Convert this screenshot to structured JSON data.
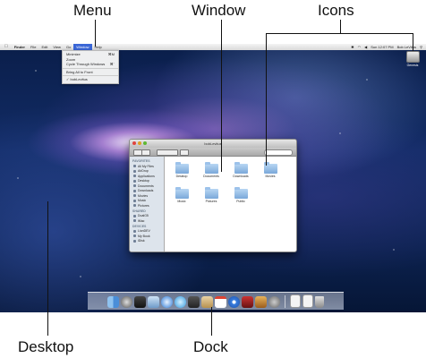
{
  "callouts": {
    "menu": "Menu",
    "window": "Window",
    "icons": "Icons",
    "desktop": "Desktop",
    "dock": "Dock"
  },
  "menubar": {
    "apple": "",
    "items": [
      "Finder",
      "File",
      "Edit",
      "View",
      "Go",
      "Window",
      "Help"
    ],
    "clock": "Sun 12:07 PM",
    "user": "Bob LeVitus"
  },
  "window_menu": {
    "items": [
      {
        "label": "Minimize",
        "shortcut": "⌘M"
      },
      {
        "label": "Zoom",
        "shortcut": ""
      },
      {
        "label": "Cycle Through Windows",
        "shortcut": "⌘`"
      },
      {
        "label": "Bring All to Front",
        "shortcut": ""
      },
      {
        "label": "✓ bobLevitus",
        "shortcut": ""
      }
    ]
  },
  "desktop_icon": {
    "label": "Genesis"
  },
  "finder": {
    "title": "bobLevitus",
    "sidebar": {
      "favorites_head": "FAVORITES",
      "favorites": [
        "All My Files",
        "AirDrop",
        "Applications",
        "Desktop",
        "Documents",
        "Downloads",
        "Movies",
        "Music",
        "Pictures"
      ],
      "shared_head": "SHARED",
      "shared": [
        "DualG5",
        "iMac"
      ],
      "devices_head": "DEVICES",
      "devices": [
        "LionDEV",
        "My Book",
        "iDisk"
      ]
    },
    "folders": [
      "Desktop",
      "Documents",
      "Downloads",
      "Movies",
      "Music",
      "Pictures",
      "Public"
    ]
  },
  "colors": {
    "menu_highlight": "#3a66d6",
    "folder": "#7aa8d9"
  },
  "dock_icons": [
    "finder-icon",
    "launchpad-icon",
    "mission-control-icon",
    "mail-icon",
    "safari-icon",
    "ichat-icon",
    "facetime-icon",
    "address-book-icon",
    "ical-icon",
    "itunes-icon",
    "photo-booth-icon",
    "iphoto-icon",
    "system-preferences-icon",
    "document-icon",
    "document-icon",
    "trash-icon"
  ]
}
